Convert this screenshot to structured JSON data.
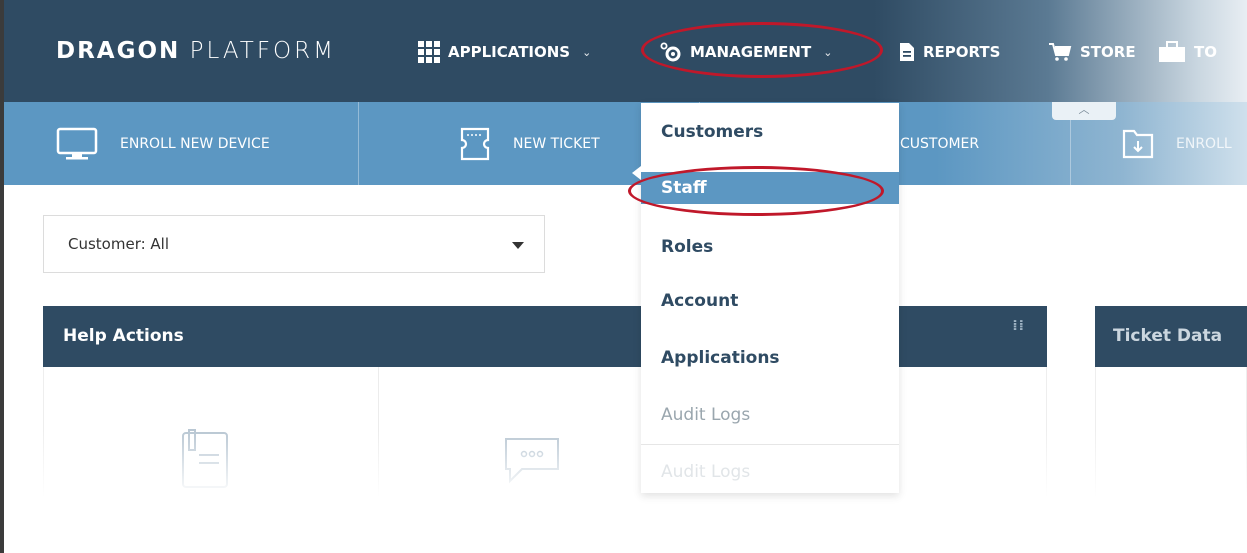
{
  "brand": {
    "bold": "DRAGON",
    "light": "PLATFORM"
  },
  "nav": {
    "applications": "APPLICATIONS",
    "management": "MANAGEMENT",
    "reports": "REPORTS",
    "store": "STORE",
    "tools_partial": "TO"
  },
  "actions": {
    "enroll_device": "ENROLL NEW DEVICE",
    "new_ticket": "NEW TICKET",
    "customer_partial": "CUSTOMER",
    "enroll_partial": "ENROLL"
  },
  "customer_select": {
    "value": "Customer: All"
  },
  "panels": {
    "help_actions": "Help Actions",
    "ticket_data": "Ticket Data"
  },
  "management_menu": {
    "items": [
      "Customers",
      "Staff",
      "Roles",
      "Account",
      "Applications",
      "Audit Logs",
      "Audit Logs"
    ],
    "selected": "Staff"
  },
  "colors": {
    "nav_bg": "#2f4b63",
    "action_bar": "#5c97c2",
    "annotation": "#c0182a"
  }
}
